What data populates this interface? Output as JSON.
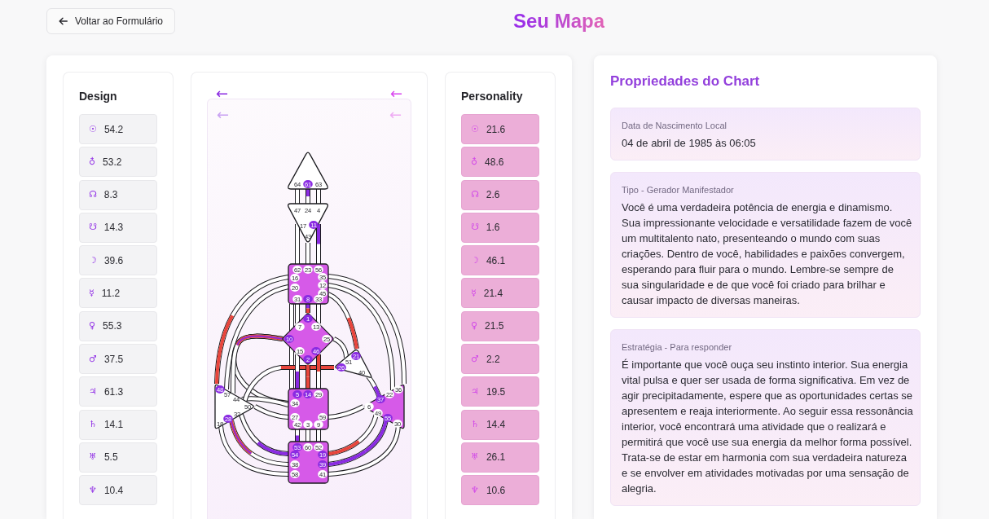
{
  "header": {
    "back_button": "Voltar ao Formulário",
    "title": "Seu Mapa"
  },
  "design_column": {
    "kind": "design",
    "title": "Design",
    "rows": [
      {
        "symbol": "☉",
        "value": "54.2"
      },
      {
        "symbol": "♁",
        "value": "53.2"
      },
      {
        "symbol": "☊",
        "value": "8.3"
      },
      {
        "symbol": "☋",
        "value": "14.3"
      },
      {
        "symbol": "☽",
        "value": "39.6"
      },
      {
        "symbol": "☿",
        "value": "11.2"
      },
      {
        "symbol": "♀",
        "value": "55.3"
      },
      {
        "symbol": "♂",
        "value": "37.5"
      },
      {
        "symbol": "♃",
        "value": "61.3"
      },
      {
        "symbol": "♄",
        "value": "14.1"
      },
      {
        "symbol": "♅",
        "value": "5.5"
      },
      {
        "symbol": "♆",
        "value": "10.4"
      }
    ]
  },
  "bodygraph": {
    "arrows": [
      {
        "glyph": "←",
        "color": "#8b2be2"
      },
      {
        "glyph": "←",
        "color": "#d946ef"
      }
    ],
    "chart_arrows": [
      {
        "glyph": "←",
        "color": "#c9a2f2"
      },
      {
        "glyph": "←",
        "color": "#eeaaf3"
      }
    ],
    "centers": [
      {
        "kind": "triangle",
        "defined": false,
        "gates": [
          {
            "number": "64",
            "design": false,
            "personality": false
          },
          {
            "number": "61",
            "design": false,
            "personality": true
          },
          {
            "number": "63",
            "design": false,
            "personality": false
          }
        ]
      },
      {
        "kind": "triangle",
        "defined": false,
        "gates": [
          {
            "number": "47",
            "design": false,
            "personality": false
          },
          {
            "number": "24",
            "design": false,
            "personality": false
          },
          {
            "number": "4",
            "design": false,
            "personality": false
          },
          {
            "number": "17",
            "design": false,
            "personality": false
          },
          {
            "number": "11",
            "design": false,
            "personality": true
          },
          {
            "number": "43",
            "design": false,
            "personality": false
          }
        ]
      },
      {
        "kind": "square",
        "defined": true,
        "gates": [
          {
            "number": "62",
            "design": false,
            "personality": false
          },
          {
            "number": "23",
            "design": false,
            "personality": false
          },
          {
            "number": "56",
            "design": false,
            "personality": false
          },
          {
            "number": "16",
            "design": false,
            "personality": false
          },
          {
            "number": "20",
            "design": false,
            "personality": false
          },
          {
            "number": "35",
            "design": false,
            "personality": false
          },
          {
            "number": "12",
            "design": false,
            "personality": false
          },
          {
            "number": "45",
            "design": false,
            "personality": false
          },
          {
            "number": "31",
            "design": false,
            "personality": false
          },
          {
            "number": "8",
            "design": false,
            "personality": true
          },
          {
            "number": "33",
            "design": false,
            "personality": false
          }
        ]
      },
      {
        "kind": "diamond",
        "defined": true,
        "gates": [
          {
            "number": "1",
            "design": true,
            "personality": false
          },
          {
            "number": "7",
            "design": false,
            "personality": false
          },
          {
            "number": "13",
            "design": false,
            "personality": false
          },
          {
            "number": "10",
            "design": true,
            "personality": true
          },
          {
            "number": "25",
            "design": false,
            "personality": false
          },
          {
            "number": "15",
            "design": false,
            "personality": false
          },
          {
            "number": "46",
            "design": true,
            "personality": false
          },
          {
            "number": "2",
            "design": true,
            "personality": false
          }
        ]
      },
      {
        "kind": "triangle",
        "defined": false,
        "gates": [
          {
            "number": "21",
            "design": true,
            "personality": false
          },
          {
            "number": "51",
            "design": false,
            "personality": false
          },
          {
            "number": "26",
            "design": true,
            "personality": false
          },
          {
            "number": "40",
            "design": false,
            "personality": false
          }
        ]
      },
      {
        "kind": "triangle",
        "defined": false,
        "gates": [
          {
            "number": "48",
            "design": true,
            "personality": false
          },
          {
            "number": "57",
            "design": false,
            "personality": false
          },
          {
            "number": "44",
            "design": false,
            "personality": false
          },
          {
            "number": "50",
            "design": false,
            "personality": false
          },
          {
            "number": "32",
            "design": false,
            "personality": false
          },
          {
            "number": "28",
            "design": true,
            "personality": true
          },
          {
            "number": "18",
            "design": false,
            "personality": false
          }
        ]
      },
      {
        "kind": "square",
        "defined": true,
        "gates": [
          {
            "number": "5",
            "design": false,
            "personality": true
          },
          {
            "number": "14",
            "design": true,
            "personality": false
          },
          {
            "number": "29",
            "design": false,
            "personality": false
          },
          {
            "number": "34",
            "design": false,
            "personality": false
          },
          {
            "number": "27",
            "design": false,
            "personality": false
          },
          {
            "number": "59",
            "design": false,
            "personality": false
          },
          {
            "number": "42",
            "design": false,
            "personality": false
          },
          {
            "number": "3",
            "design": false,
            "personality": false
          },
          {
            "number": "9",
            "design": false,
            "personality": false
          }
        ]
      },
      {
        "kind": "triangle",
        "defined": true,
        "gates": [
          {
            "number": "36",
            "design": false,
            "personality": false
          },
          {
            "number": "22",
            "design": false,
            "personality": false
          },
          {
            "number": "37",
            "design": false,
            "personality": true
          },
          {
            "number": "6",
            "design": false,
            "personality": false
          },
          {
            "number": "49",
            "design": false,
            "personality": false
          },
          {
            "number": "55",
            "design": false,
            "personality": true
          },
          {
            "number": "30",
            "design": false,
            "personality": false
          }
        ]
      },
      {
        "kind": "square",
        "defined": true,
        "gates": [
          {
            "number": "53",
            "design": false,
            "personality": true
          },
          {
            "number": "60",
            "design": false,
            "personality": false
          },
          {
            "number": "52",
            "design": false,
            "personality": false
          },
          {
            "number": "54",
            "design": false,
            "personality": true
          },
          {
            "number": "19",
            "design": true,
            "personality": false
          },
          {
            "number": "38",
            "design": false,
            "personality": false
          },
          {
            "number": "39",
            "design": false,
            "personality": true
          },
          {
            "number": "58",
            "design": false,
            "personality": false
          },
          {
            "number": "41",
            "design": false,
            "personality": false
          }
        ]
      }
    ]
  },
  "personality_column": {
    "kind": "personality",
    "title": "Personality",
    "rows": [
      {
        "symbol": "☉",
        "value": "21.6"
      },
      {
        "symbol": "♁",
        "value": "48.6"
      },
      {
        "symbol": "☊",
        "value": "2.6"
      },
      {
        "symbol": "☋",
        "value": "1.6"
      },
      {
        "symbol": "☽",
        "value": "46.1"
      },
      {
        "symbol": "☿",
        "value": "21.4"
      },
      {
        "symbol": "♀",
        "value": "21.5"
      },
      {
        "symbol": "♂",
        "value": "2.2"
      },
      {
        "symbol": "♃",
        "value": "19.5"
      },
      {
        "symbol": "♄",
        "value": "14.4"
      },
      {
        "symbol": "♅",
        "value": "26.1"
      },
      {
        "symbol": "♆",
        "value": "10.6"
      }
    ]
  },
  "properties": {
    "title": "Propriedades do Chart",
    "items": [
      {
        "label": "Data de Nascimento Local",
        "text": "04 de abril de 1985 às 06:05"
      },
      {
        "label": "Tipo - Gerador Manifestador",
        "text": "Você é uma verdadeira potência de energia e dinamismo. Sua impressionante velocidade e versatilidade fazem de você um multitalento nato, presenteando o mundo com suas criações. Dentro de você, habilidades e paixões convergem, esperando para fluir para o mundo. Lembre-se sempre de sua singularidade e de que você foi criado para brilhar e causar impacto de diversas maneiras."
      },
      {
        "label": "Estratégia - Para responder",
        "text": "É importante que você ouça seu instinto interior. Sua energia vital pulsa e quer ser usada de forma significativa. Em vez de agir precipitadamente, espere que as oportunidades certas se apresentem e reaja interiormente. Ao seguir essa ressonância interior, você encontrará uma atividade que o realizará e permitirá que você use sua energia da melhor forma possível. Trata-se de estar em harmonia com sua verdadeira natureza e se envolver em atividades motivadas por uma sensação de alegria."
      }
    ]
  }
}
